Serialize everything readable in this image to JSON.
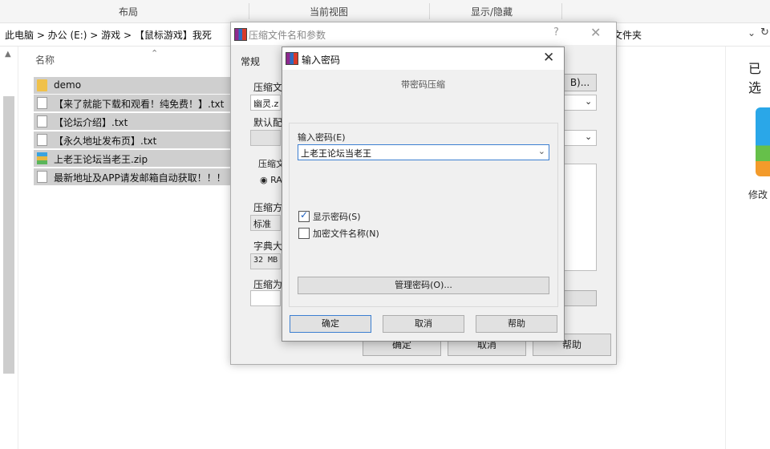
{
  "ribbon": {
    "groups": [
      "布局",
      "当前视图",
      "显示/隐藏"
    ]
  },
  "address": {
    "breadcrumb": "此电脑  >  办公 (E:)  >  游戏  >  【鼠标游戏】我死",
    "tail": "文件夹"
  },
  "file_list": {
    "column_name": "名称",
    "items": [
      {
        "name": "demo",
        "icon": "folder-icon"
      },
      {
        "name": "【来了就能下载和观看！纯免费！】.txt",
        "icon": "txt-file-icon"
      },
      {
        "name": "【论坛介绍】.txt",
        "icon": "txt-file-icon"
      },
      {
        "name": "【永久地址发布页】.txt",
        "icon": "txt-file-icon"
      },
      {
        "name": "上老王论坛当老王.zip",
        "icon": "zip-archive-icon"
      },
      {
        "name": "最新地址及APP请发邮箱自动获取！！！",
        "icon": "txt-file-icon"
      }
    ]
  },
  "preview": {
    "title": "已选",
    "modify": "修改"
  },
  "archive_dialog": {
    "title": "压缩文件名和参数",
    "help_glyph": "?",
    "tab_general": "常规",
    "fragments": [
      "压缩文",
      "幽灵.z",
      "默认配",
      "压缩文",
      "RA",
      "压缩方",
      "标准",
      "字典大",
      "32 MB",
      "压缩为"
    ],
    "browse_label": "B)...",
    "ok": "确定",
    "cancel": "取消",
    "help": "帮助"
  },
  "password_dialog": {
    "title": "输入密码",
    "subtitle": "带密码压缩",
    "label_enter": "输入密码(E)",
    "password_value": "上老王论坛当老王",
    "show_password": {
      "label": "显示密码(S)",
      "checked": true
    },
    "encrypt_names": {
      "label": "加密文件名称(N)",
      "checked": false
    },
    "manage_button": "管理密码(O)...",
    "ok": "确定",
    "cancel": "取消",
    "help": "帮助"
  }
}
